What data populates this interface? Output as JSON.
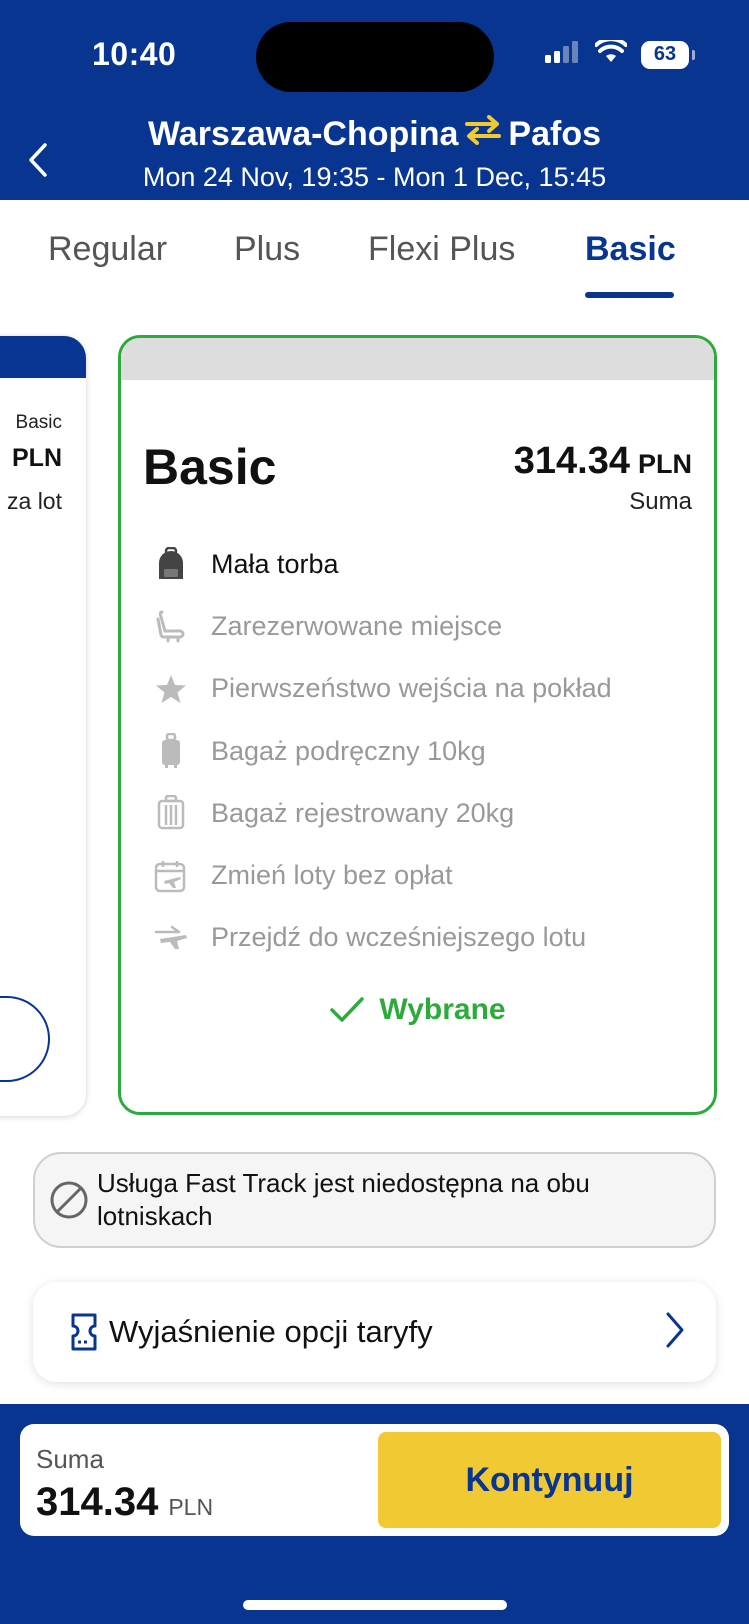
{
  "status": {
    "time": "10:40",
    "battery": "63"
  },
  "header": {
    "origin": "Warszawa-Chopina",
    "destination": "Pafos",
    "dates": "Mon 24 Nov, 19:35 - Mon 1 Dec, 15:45"
  },
  "tabs": [
    {
      "label": "Regular",
      "active": false
    },
    {
      "label": "Plus",
      "active": false
    },
    {
      "label": "Flexi Plus",
      "active": false
    },
    {
      "label": "Basic",
      "active": true
    }
  ],
  "left_card": {
    "name": "Basic",
    "currency": "PLN",
    "per": "za lot"
  },
  "fare": {
    "name": "Basic",
    "price": "314.34",
    "currency": "PLN",
    "price_caption": "Suma",
    "features": [
      {
        "icon": "backpack-icon",
        "label": "Mała torba",
        "included": true
      },
      {
        "icon": "seat-icon",
        "label": "Zarezerwowane miejsce",
        "included": false
      },
      {
        "icon": "star-icon",
        "label": "Pierwszeństwo wejścia na pokład",
        "included": false
      },
      {
        "icon": "cabin-bag-icon",
        "label": "Bagaż podręczny 10kg",
        "included": false
      },
      {
        "icon": "checked-bag-icon",
        "label": "Bagaż rejestrowany 20kg",
        "included": false
      },
      {
        "icon": "calendar-plane-icon",
        "label": "Zmień loty bez opłat",
        "included": false
      },
      {
        "icon": "plane-swap-icon",
        "label": "Przejdź do wcześniejszego lotu",
        "included": false
      }
    ],
    "selected_label": "Wybrane"
  },
  "notice": {
    "icon": "prohibited-icon",
    "text": "Usługa Fast Track jest niedostępna na obu lotniskach"
  },
  "explain": {
    "icon": "ticket-icon",
    "label": "Wyjaśnienie opcji taryfy"
  },
  "footer": {
    "sum_label": "Suma",
    "price": "314.34",
    "currency": "PLN",
    "continue_label": "Kontynuuj"
  },
  "colors": {
    "brand_blue": "#073590",
    "selected_green": "#2eaa3c",
    "cta_yellow": "#f1c933",
    "swap_yellow": "#f1c933"
  }
}
